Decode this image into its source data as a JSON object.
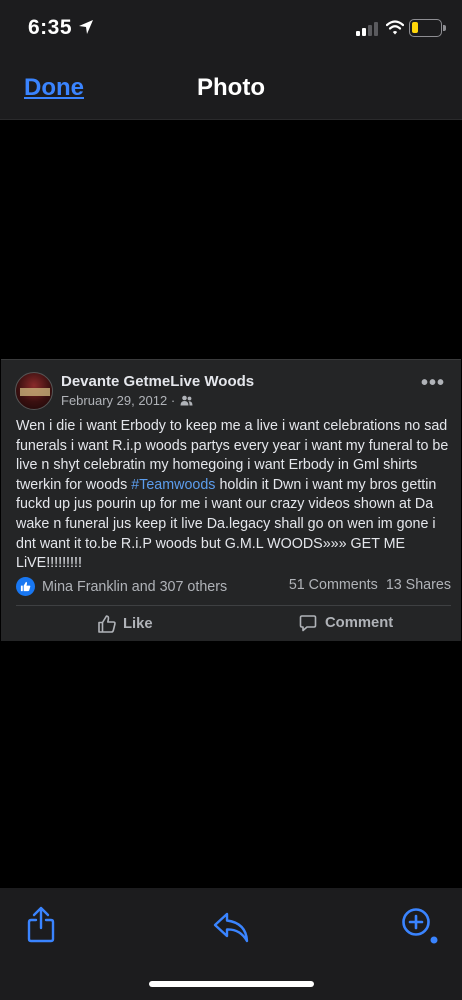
{
  "status_bar": {
    "time": "6:35"
  },
  "nav": {
    "done_label": "Done",
    "title": "Photo"
  },
  "post": {
    "author": "Devante GetmeLive Woods",
    "date": "February 29, 2012 ·",
    "audience_icon": "friends-icon",
    "text_before": "Wen i die i want Erbody to keep me a live i want celebrations no sad funerals i want R.i.p woods partys every year i want my funeral to be live n shyt celebratin my homegoing i want Erbody in Gml shirts twerkin for woods ",
    "hashtag": "#Teamwoods",
    "text_after": " holdin it Dwn i want my bros gettin fuckd up jus pourin up for me i want our crazy videos shown at Da wake n funeral jus keep it live Da.legacy shall go on wen im gone i dnt want it to.be R.i.P woods but G.M.L WOODS»»» GET ME LiVE!!!!!!!!!",
    "reactions_text": "Mina Franklin and 307 others",
    "comments_count": "51 Comments",
    "shares_count": "13 Shares",
    "like_label": "Like",
    "comment_label": "Comment"
  },
  "toolbar": {
    "icons": [
      "share-icon",
      "reply-icon",
      "zoom-in-icon"
    ]
  },
  "colors": {
    "accent": "#3a84ff",
    "hashtag": "#5c9ded",
    "card": "#242526",
    "battery": "#ffd60a"
  }
}
